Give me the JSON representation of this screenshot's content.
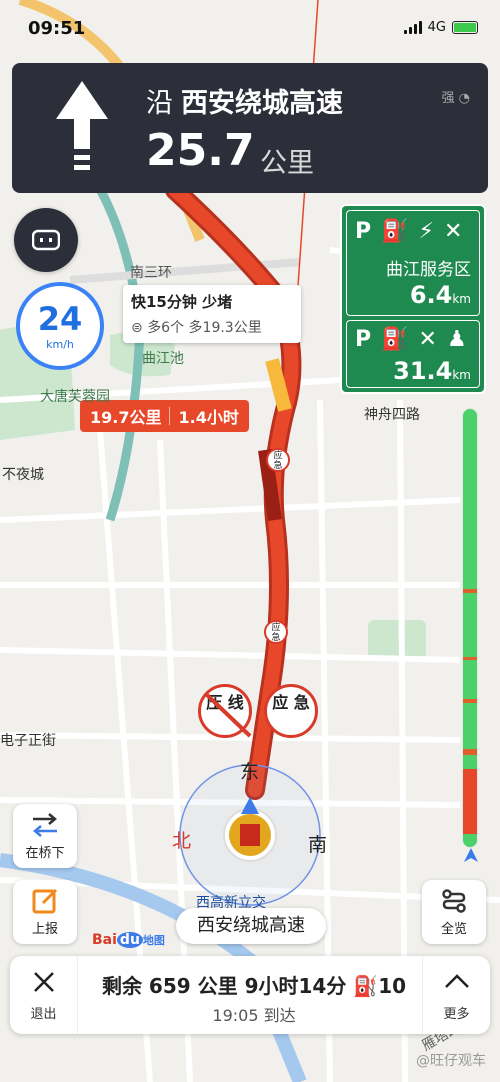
{
  "status": {
    "time": "09:51",
    "network": "4G"
  },
  "nav": {
    "prefix": "沿",
    "road": "西安绕城高速",
    "distance": "25.7",
    "unit": "公里",
    "signal": "强"
  },
  "speed": {
    "value": "24",
    "unit": "km/h"
  },
  "service_areas": [
    {
      "name": "曲江服务区",
      "distance": "6.4",
      "unit": "km"
    },
    {
      "distance": "31.4",
      "unit": "km"
    }
  ],
  "callout": {
    "line1": "快15分钟 少堵",
    "line2": "多6个 多19.3公里"
  },
  "route_badge": {
    "distance": "19.7公里",
    "time": "1.4小时"
  },
  "map_labels": {
    "qujiangchi": "曲江池",
    "datang": "大唐芙蓉园",
    "buyecheng": "不夜城",
    "shenzhou": "神舟四路",
    "zizheng": "电子正街",
    "nansanhuan": "南三环",
    "xigao": "西高新立交",
    "yanzhou": "雁塔路"
  },
  "compass": {
    "east": "东",
    "north": "北",
    "south": "南"
  },
  "warnings": {
    "ya_xian": "压 线",
    "ying_ji": "应 急",
    "small_ying": "应 急"
  },
  "buttons": {
    "bridge": "在桥下",
    "report": "上报",
    "overview": "全览"
  },
  "current_road": "西安绕城高速",
  "baidu_logo": "Bai 地图",
  "bottom": {
    "exit": "退出",
    "more": "更多",
    "remaining": "剩余 659 公里 9小时14分 ⛽10",
    "arrival": "19:05 到达"
  },
  "watermark": "@旺仔观车",
  "colors": {
    "route_jam": "#e8482a",
    "route_smooth": "#4cd06a",
    "service_green": "#1e8a50",
    "nav_bg": "#2c2f3a"
  }
}
